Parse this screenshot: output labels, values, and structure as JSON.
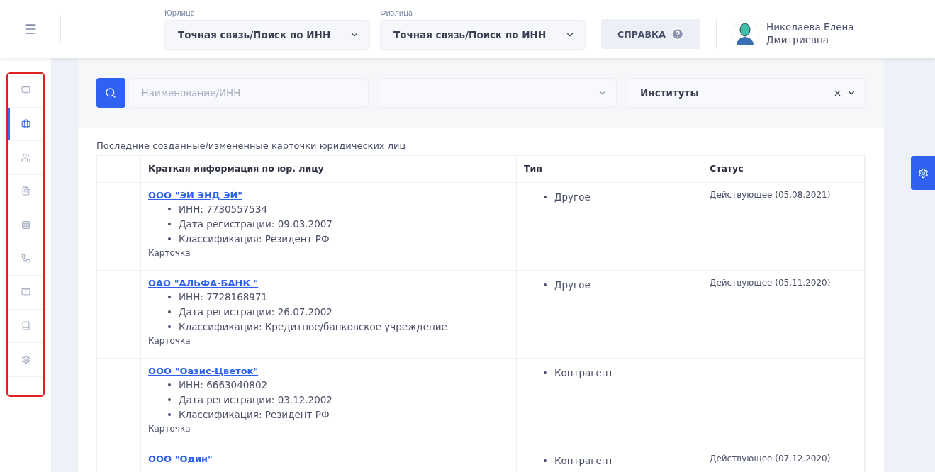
{
  "header": {
    "selects": [
      {
        "label": "Юрлица",
        "value": "Точная связь/Поиск по ИНН"
      },
      {
        "label": "Физлица",
        "value": "Точная связь/Поиск по ИНН"
      }
    ],
    "help_button": "СПРАВКА",
    "user_name": "Николаева Елена Дмитриевна"
  },
  "sidebar": {
    "items": [
      {
        "kind": "monitor",
        "selected": false
      },
      {
        "kind": "briefcase",
        "selected": true
      },
      {
        "kind": "users",
        "selected": false
      },
      {
        "kind": "file",
        "selected": false
      },
      {
        "kind": "table",
        "selected": false
      },
      {
        "kind": "phone",
        "selected": false
      },
      {
        "kind": "book-open",
        "selected": false
      },
      {
        "kind": "book",
        "selected": false
      },
      {
        "kind": "settings",
        "selected": false
      }
    ]
  },
  "filters": {
    "search_placeholder": "Наименование/ИНН",
    "category": "Институты"
  },
  "table": {
    "marker": "•",
    "caption": "Последние созданные/измененные карточки юридических лиц",
    "columns": [
      "Краткая информация по юр. лицу",
      "Тип",
      "Статус"
    ],
    "rows": [
      {
        "name": "ООО \"ЭЙ ЭНД ЭЙ\"",
        "details": [
          "ИНН: 7730557534",
          "Дата регистрации: 09.03.2007",
          "Классификация: Резидент РФ"
        ],
        "card": "Карточка",
        "types": [
          "Другое"
        ],
        "status": "Действующее (05.08.2021)"
      },
      {
        "name": "ОАО \"АЛЬФА-БАНК \"",
        "details": [
          "ИНН: 7728168971",
          "Дата регистрации: 26.07.2002",
          "Классификация: Кредитное/банковское учреждение"
        ],
        "card": "Карточка",
        "types": [
          "Другое"
        ],
        "status": "Действующее (05.11.2020)"
      },
      {
        "name": "ООО \"Оазис-Цветок\"",
        "details": [
          "ИНН: 6663040802",
          "Дата регистрации: 03.12.2002",
          "Классификация: Резидент РФ"
        ],
        "card": "Карточка",
        "types": [
          "Контрагент"
        ]
      },
      {
        "name": "ООО \"Один\"",
        "types": [
          "Контрагент"
        ],
        "status": "Действующее (07.12.2020)"
      }
    ]
  }
}
